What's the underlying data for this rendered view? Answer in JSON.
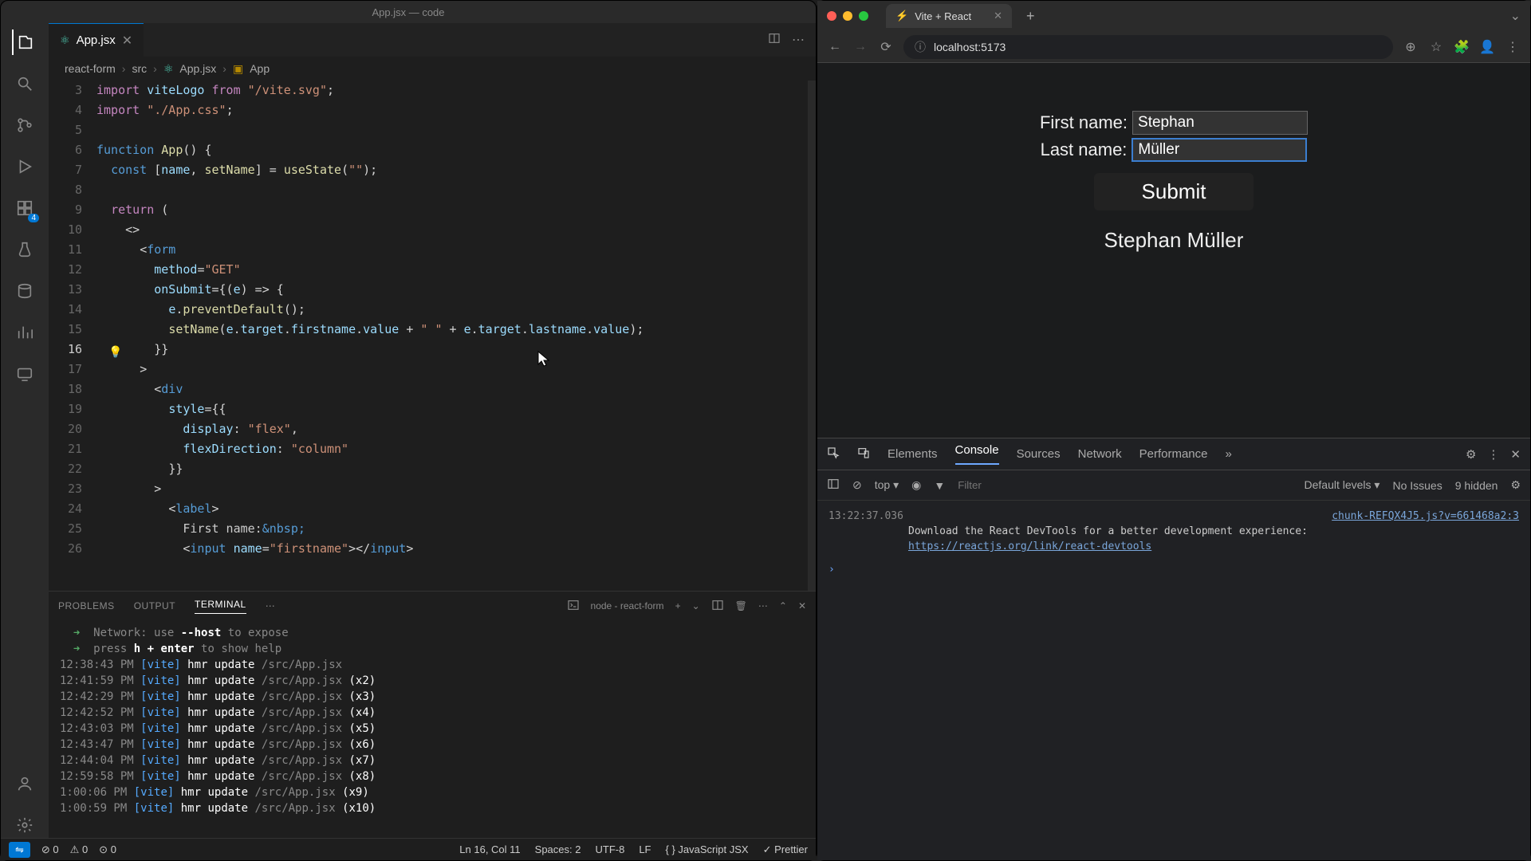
{
  "vscode": {
    "title": "App.jsx — code",
    "tab": {
      "label": "App.jsx"
    },
    "tabs_actions": {
      "split": "▯▯",
      "more": "⋯"
    },
    "breadcrumb": [
      "react-form",
      "src",
      "App.jsx",
      "App"
    ],
    "code_lines": [
      {
        "n": 3,
        "html": "<span class='tok-kw'>import</span> <span class='tok-var'>viteLogo</span> <span class='tok-kw'>from</span> <span class='tok-str'>\"/vite.svg\"</span><span class='tok-punc'>;</span>"
      },
      {
        "n": 4,
        "html": "<span class='tok-kw'>import</span> <span class='tok-str'>\"./App.css\"</span><span class='tok-punc'>;</span>"
      },
      {
        "n": 5,
        "html": ""
      },
      {
        "n": 6,
        "html": "<span class='tok-kw2'>function</span> <span class='tok-fn'>App</span><span class='tok-punc'>() {</span>"
      },
      {
        "n": 7,
        "html": "  <span class='tok-kw2'>const</span> <span class='tok-punc'>[</span><span class='tok-var'>name</span><span class='tok-punc'>,</span> <span class='tok-fn'>setName</span><span class='tok-punc'>] = </span><span class='tok-fn'>useState</span><span class='tok-punc'>(</span><span class='tok-str'>\"\"</span><span class='tok-punc'>);</span>"
      },
      {
        "n": 8,
        "html": ""
      },
      {
        "n": 9,
        "html": "  <span class='tok-kw'>return</span> <span class='tok-punc'>(</span>"
      },
      {
        "n": 10,
        "html": "    <span class='tok-punc'>&lt;&gt;</span>"
      },
      {
        "n": 11,
        "html": "      <span class='tok-punc'>&lt;</span><span class='tok-kw2'>form</span>"
      },
      {
        "n": 12,
        "html": "        <span class='tok-attr'>method</span><span class='tok-punc'>=</span><span class='tok-str'>\"GET\"</span>"
      },
      {
        "n": 13,
        "html": "        <span class='tok-attr'>onSubmit</span><span class='tok-punc'>={(</span><span class='tok-var'>e</span><span class='tok-punc'>) =&gt; {</span>"
      },
      {
        "n": 14,
        "html": "          <span class='tok-var'>e</span><span class='tok-punc'>.</span><span class='tok-fn'>preventDefault</span><span class='tok-punc'>();</span>"
      },
      {
        "n": 15,
        "html": "          <span class='tok-fn'>setName</span><span class='tok-punc'>(</span><span class='tok-var'>e</span><span class='tok-punc'>.</span><span class='tok-var'>target</span><span class='tok-punc'>.</span><span class='tok-var'>firstname</span><span class='tok-punc'>.</span><span class='tok-var'>value</span> <span class='tok-punc'>+</span> <span class='tok-str'>\" \"</span> <span class='tok-punc'>+</span> <span class='tok-var'>e</span><span class='tok-punc'>.</span><span class='tok-var'>target</span><span class='tok-punc'>.</span><span class='tok-var'>lastname</span><span class='tok-punc'>.</span><span class='tok-var'>value</span><span class='tok-punc'>);</span>"
      },
      {
        "n": 16,
        "html": "        <span class='tok-punc'>}}</span>",
        "current": true
      },
      {
        "n": 17,
        "html": "      <span class='tok-punc'>&gt;</span>"
      },
      {
        "n": 18,
        "html": "        <span class='tok-punc'>&lt;</span><span class='tok-kw2'>div</span>"
      },
      {
        "n": 19,
        "html": "          <span class='tok-attr'>style</span><span class='tok-punc'>={{</span>"
      },
      {
        "n": 20,
        "html": "            <span class='tok-var'>display</span><span class='tok-punc'>:</span> <span class='tok-str'>\"flex\"</span><span class='tok-punc'>,</span>"
      },
      {
        "n": 21,
        "html": "            <span class='tok-var'>flexDirection</span><span class='tok-punc'>:</span> <span class='tok-str'>\"column\"</span>"
      },
      {
        "n": 22,
        "html": "          <span class='tok-punc'>}}</span>"
      },
      {
        "n": 23,
        "html": "        <span class='tok-punc'>&gt;</span>"
      },
      {
        "n": 24,
        "html": "          <span class='tok-punc'>&lt;</span><span class='tok-kw2'>label</span><span class='tok-punc'>&gt;</span>"
      },
      {
        "n": 25,
        "html": "            First name:<span class='tok-kw2'>&amp;nbsp;</span>"
      },
      {
        "n": 26,
        "html": "            <span class='tok-punc'>&lt;</span><span class='tok-kw2'>input</span> <span class='tok-attr'>name</span><span class='tok-punc'>=</span><span class='tok-str'>\"firstname\"</span><span class='tok-punc'>&gt;&lt;/</span><span class='tok-kw2'>input</span><span class='tok-punc'>&gt;</span>"
      }
    ],
    "panel": {
      "tabs": [
        "PROBLEMS",
        "OUTPUT",
        "TERMINAL"
      ],
      "active": "TERMINAL",
      "task": "node - react-form"
    },
    "terminal_lines": [
      "  <span class='t-arrow'>➜</span>  <span class='t-dim'>Network: use</span> <span class='t-host'>--host</span> <span class='t-dim'>to expose</span>",
      "  <span class='t-arrow'>➜</span>  <span class='t-dim'>press</span> <span class='t-host'>h + enter</span> <span class='t-dim'>to show help</span>",
      "<span class='t-time'>12:38:43 PM</span> <span class='t-vite'>[vite]</span> <span class='t-upd'>hmr update</span> <span class='t-path'>/src/App.jsx</span>",
      "<span class='t-time'>12:41:59 PM</span> <span class='t-vite'>[vite]</span> <span class='t-upd'>hmr update</span> <span class='t-path'>/src/App.jsx</span> <span class='t-upd'>(x2)</span>",
      "<span class='t-time'>12:42:29 PM</span> <span class='t-vite'>[vite]</span> <span class='t-upd'>hmr update</span> <span class='t-path'>/src/App.jsx</span> <span class='t-upd'>(x3)</span>",
      "<span class='t-time'>12:42:52 PM</span> <span class='t-vite'>[vite]</span> <span class='t-upd'>hmr update</span> <span class='t-path'>/src/App.jsx</span> <span class='t-upd'>(x4)</span>",
      "<span class='t-time'>12:43:03 PM</span> <span class='t-vite'>[vite]</span> <span class='t-upd'>hmr update</span> <span class='t-path'>/src/App.jsx</span> <span class='t-upd'>(x5)</span>",
      "<span class='t-time'>12:43:47 PM</span> <span class='t-vite'>[vite]</span> <span class='t-upd'>hmr update</span> <span class='t-path'>/src/App.jsx</span> <span class='t-upd'>(x6)</span>",
      "<span class='t-time'>12:44:04 PM</span> <span class='t-vite'>[vite]</span> <span class='t-upd'>hmr update</span> <span class='t-path'>/src/App.jsx</span> <span class='t-upd'>(x7)</span>",
      "<span class='t-time'>12:59:58 PM</span> <span class='t-vite'>[vite]</span> <span class='t-upd'>hmr update</span> <span class='t-path'>/src/App.jsx</span> <span class='t-upd'>(x8)</span>",
      "<span class='t-time'>1:00:06 PM</span> <span class='t-vite'>[vite]</span> <span class='t-upd'>hmr update</span> <span class='t-path'>/src/App.jsx</span> <span class='t-upd'>(x9)</span>",
      "<span class='t-time'>1:00:59 PM</span> <span class='t-vite'>[vite]</span> <span class='t-upd'>hmr update</span> <span class='t-path'>/src/App.jsx</span> <span class='t-upd'>(x10)</span>"
    ],
    "status": {
      "errors": "0",
      "warnings": "0",
      "ports": "0",
      "cursor": "Ln 16, Col 11",
      "spaces": "Spaces: 2",
      "encoding": "UTF-8",
      "eol": "LF",
      "lang": "JavaScript JSX",
      "prettier": "Prettier"
    },
    "activity_badge": "4"
  },
  "browser": {
    "tab_title": "Vite + React",
    "url": "localhost:5173",
    "form": {
      "first_label": "First name:",
      "first_value": "Stephan",
      "last_label": "Last name:",
      "last_value": "Müller",
      "submit": "Submit",
      "result": "Stephan Müller"
    }
  },
  "devtools": {
    "tabs": [
      "Elements",
      "Console",
      "Sources",
      "Network",
      "Performance"
    ],
    "active": "Console",
    "more": "»",
    "toolbar": {
      "ctx": "top",
      "filter_placeholder": "Filter",
      "levels": "Default levels",
      "issues": "No Issues",
      "hidden": "9 hidden"
    },
    "console": {
      "ts": "13:22:37.036",
      "src": "chunk-REFQX4J5.js?v=661468a2:3",
      "msg": "Download the React DevTools for a better development experience:",
      "link": "https://reactjs.org/link/react-devtools"
    }
  }
}
